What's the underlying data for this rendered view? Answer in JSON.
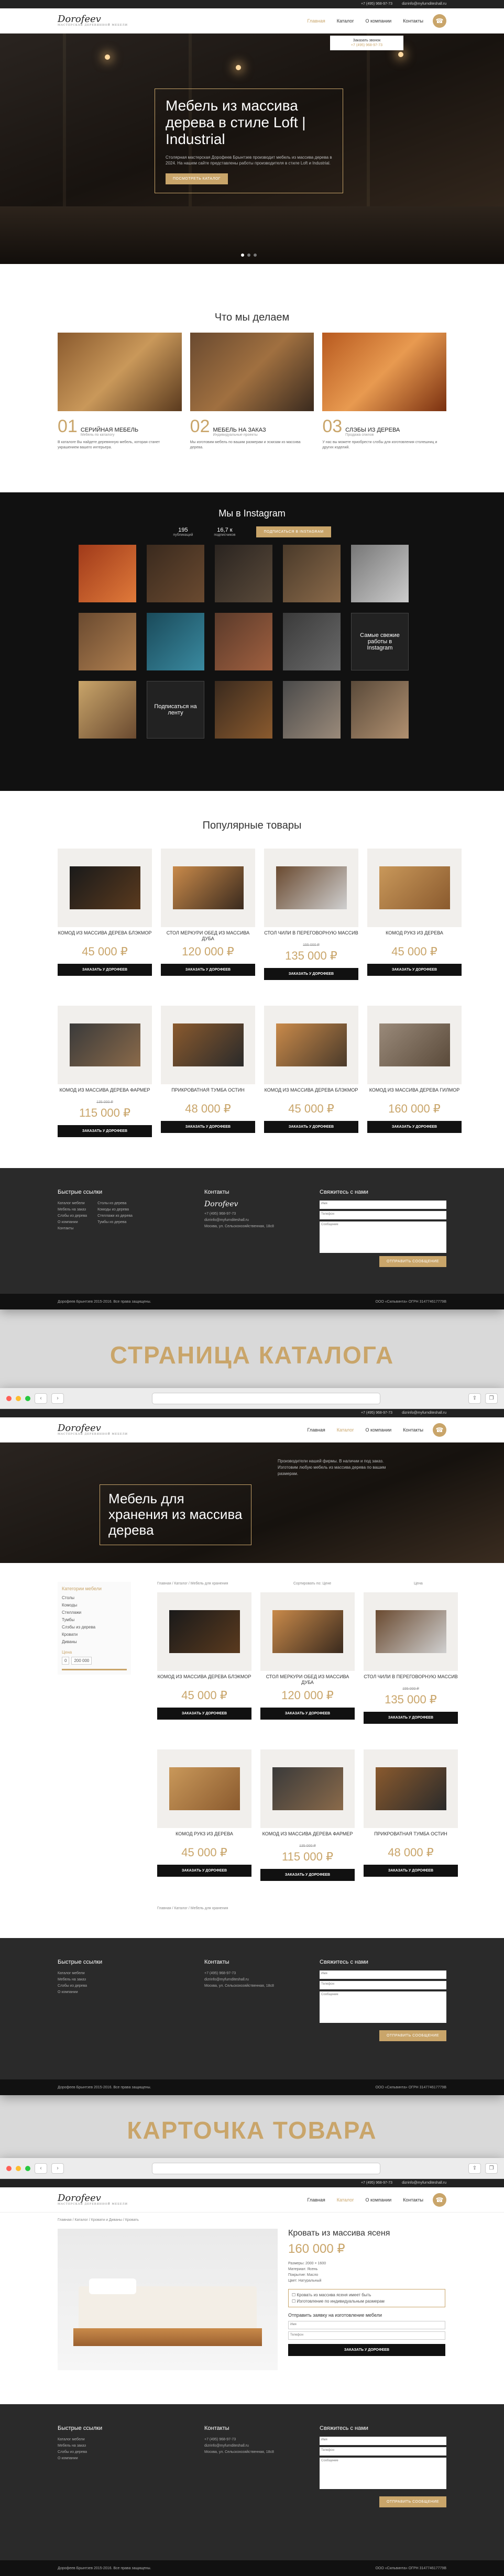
{
  "topbar": {
    "phone": "+7 (495) 968-97-73",
    "email": "dizrinfo@myfurnditeshall.ru"
  },
  "brand": {
    "logo": "Dorofeev",
    "tag": "МАСТЕРСКАЯ ДЕРЕВЯННОЙ МЕБЕЛИ"
  },
  "nav": [
    "Главная",
    "Каталог",
    "О компании",
    "Контакты"
  ],
  "callback": {
    "label": "Заказать звонок",
    "phone": "+7 (495) 968-97-73"
  },
  "hero": {
    "title": "Мебель из массива дерева в стиле Loft | Industrial",
    "text": "Столярная мастерская Дорофеев Брынтзев производит мебель из массива дерева в 2024. На нашем сайте представлены работы производителя в стиле Loft и Industrial.",
    "button": "ПОСМОТРЕТЬ КАТАЛОГ"
  },
  "what": {
    "title": "Что мы делаем",
    "items": [
      {
        "num": "01",
        "title": "СЕРИЙНАЯ МЕБЕЛЬ",
        "sub": "Мебель по каталогу",
        "text": "В каталоге Вы найдете деревянную мебель, которая станет украшением вашего интерьера."
      },
      {
        "num": "02",
        "title": "МЕБЕЛЬ НА ЗАКАЗ",
        "sub": "Индивидуальные проекты",
        "text": "Мы изготовим мебель по вашим размерам и эскизам из массива дерева."
      },
      {
        "num": "03",
        "title": "СЛЭБЫ ИЗ ДЕРЕВА",
        "sub": "Продажа спилов",
        "text": "У нас вы можете приобрести слэбы для изготовления столешниц и других изделий."
      }
    ]
  },
  "insta": {
    "title": "Мы в Instagram",
    "pubs": "195",
    "pubs_label": "публикаций",
    "subs": "16,7 к",
    "subs_label": "подписчиков",
    "button": "ПОДПИСАТЬСЯ В INSTAGRAM",
    "more": "Самые свежие работы в Instagram",
    "follow": "Подписаться на ленту"
  },
  "popular": {
    "title": "Популярные товары",
    "button": "ЗАКАЗАТЬ У ДОРОФЕЕВ",
    "items": [
      {
        "name": "КОМОД ИЗ МАССИВА ДЕРЕВА БЛЭКМОР",
        "price": "45 000 ₽",
        "old": ""
      },
      {
        "name": "СТОЛ МЕРКУРИ ОБЕД ИЗ МАССИВА ДУБА",
        "price": "120 000 ₽",
        "old": ""
      },
      {
        "name": "СТОЛ ЧИЛИ В ПЕРЕГОВОРНУЮ МАССИВ",
        "price": "135 000 ₽",
        "old": "155 000 ₽"
      },
      {
        "name": "КОМОД РУКЗ ИЗ ДЕРЕВА",
        "price": "45 000 ₽",
        "old": ""
      },
      {
        "name": "КОМОД ИЗ МАССИВА ДЕРЕВА ФАРМЕР",
        "price": "115 000 ₽",
        "old": "135 000 ₽"
      },
      {
        "name": "ПРИКРОВАТНАЯ ТУМБА ОСТИН",
        "price": "48 000 ₽",
        "old": ""
      },
      {
        "name": "КОМОД ИЗ МАССИВА ДЕРЕВА БЛЭКМОР",
        "price": "45 000 ₽",
        "old": ""
      },
      {
        "name": "КОМОД ИЗ МАССИВА ДЕРЕВА ГИЛМОР",
        "price": "160 000 ₽",
        "old": ""
      }
    ]
  },
  "footer": {
    "links_title": "Быстрые ссылки",
    "links": [
      "Каталог мебели",
      "Мебель на заказ",
      "Слэбы из дерева",
      "О компании",
      "Контакты"
    ],
    "links2": [
      "Столы из дерева",
      "Комоды из дерева",
      "Стеллажи из дерева",
      "Тумбы из дерева"
    ],
    "contacts_title": "Контакты",
    "contacts": [
      "+7 (495) 968-97-73",
      "dizrinfo@myfurnditeshall.ru",
      "Москва, ул. Сельскохозяйственная, 18с8"
    ],
    "form_title": "Свяжитесь с нами",
    "f_name": "Имя",
    "f_phone": "Телефон",
    "f_msg": "Сообщение",
    "f_btn": "ОТПРАВИТЬ СООБЩЕНИЕ",
    "copy": "Дорофеев Брынтзев 2015-2016. Все права защищены.",
    "company": "ООО «Сильвинта» ОГРН 314774617779B"
  },
  "catalog": {
    "label": "СТРАНИЦА КАТАЛОГА",
    "title": "Мебель для хранения из массива дерева",
    "text": "Производители нашей фирмы. В наличии и под заказ. Изготовим любую мебель из массива дерева по вашим размерам.",
    "sidebar_title": "Категории мебели",
    "cats": [
      "Столы",
      "Комоды",
      "Стеллажи",
      "Тумбы",
      "Слэбы из дерева",
      "Кровати",
      "Диваны"
    ],
    "price": "Цена",
    "from": "0",
    "to": "200 000",
    "breadcrumb": "Главная / Каталог / Мебель для хранения",
    "sort": "Сортировать по: Цене",
    "view": "Цена"
  },
  "product": {
    "label": "КАРТОЧКА ТОВАРА",
    "breadcrumb": "Главная / Каталог / Кровати и Диваны / Кровать",
    "title": "Кровать из массива ясеня",
    "price": "160 000 ₽",
    "specs": [
      "Размеры: 2000 × 1600",
      "Материал: Ясень",
      "Покрытие: Масло",
      "Цвет: Натуральный"
    ],
    "check1": "Кровать из массива ясеня имеет быть",
    "check2": "Изготовление по индивидуальным размерам",
    "order_title": "Отправить заявку на изготовление мебели",
    "btn": "ЗАКАЗАТЬ У ДОРОФЕЕВ"
  },
  "colors": {
    "gold": "#c9a56a",
    "dark": "#2a2a2a"
  }
}
